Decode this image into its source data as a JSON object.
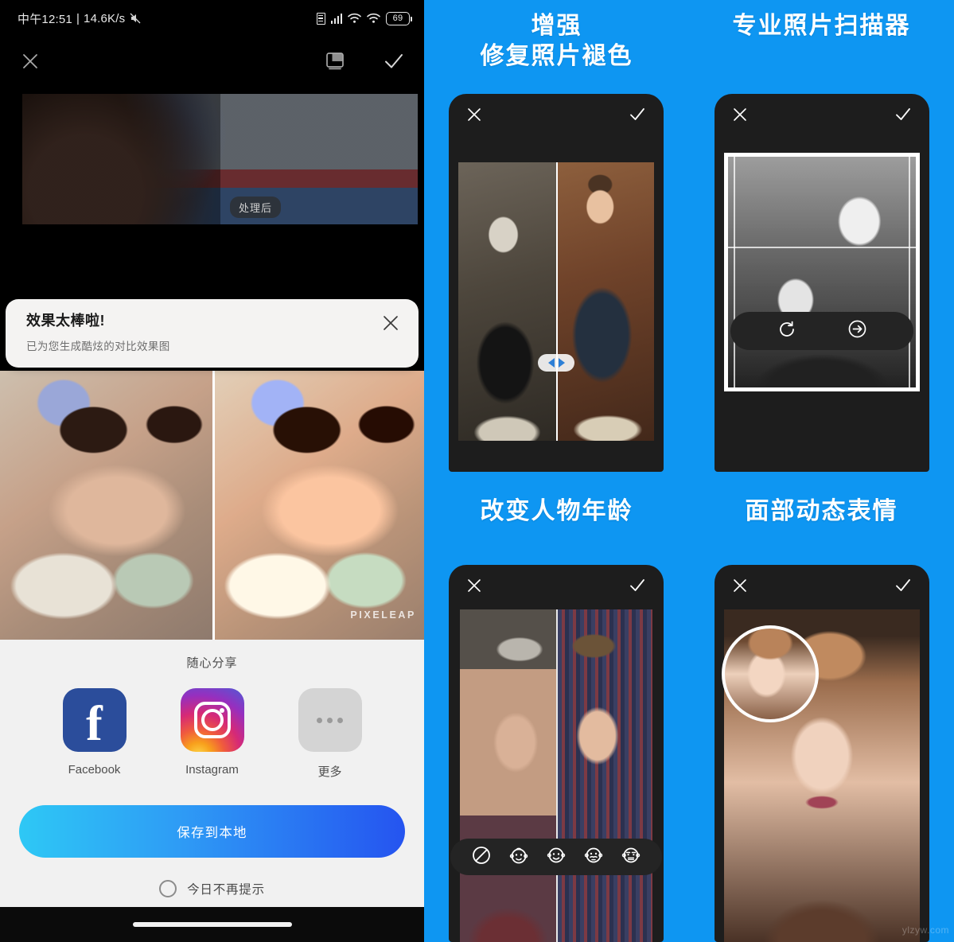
{
  "left_phone": {
    "status_bar": {
      "time": "中午12:51",
      "separator": "|",
      "net_speed": "14.6K/s",
      "mute_icon": "mute-icon",
      "sim_icon": "sim-card-icon",
      "signal_icon": "signal-bars-icon",
      "wifi_icon": "wifi-icon",
      "wifi_secondary_icon": "wifi-secondary-icon",
      "battery_level": "69"
    },
    "editor_toolbar": {
      "close_icon": "close-icon",
      "compare_icon": "compare-layers-icon",
      "confirm_icon": "check-icon"
    },
    "preview": {
      "badge_after": "处理后"
    },
    "toast": {
      "title": "效果太棒啦!",
      "subtitle": "已为您生成酷炫的对比效果图",
      "close_icon": "close-icon"
    },
    "result_image": {
      "watermark": "PIXELEAP"
    },
    "share": {
      "title": "随心分享",
      "apps": [
        {
          "label": "Facebook",
          "icon": "facebook-icon"
        },
        {
          "label": "Instagram",
          "icon": "instagram-icon"
        },
        {
          "label": "更多",
          "icon": "more-dots-icon"
        }
      ],
      "save_button": "保存到本地",
      "dont_remind_label": "今日不再提示",
      "dont_remind_checked": false
    },
    "gesture_bar": "home-indicator"
  },
  "promo_panel": {
    "background_color": "#0e96f2",
    "cells": [
      {
        "heading": "增强\n修复照片褪色",
        "close_icon": "close-icon",
        "confirm_icon": "check-icon",
        "control": "before-after-slider"
      },
      {
        "heading": "专业照片扫描器",
        "close_icon": "close-icon",
        "confirm_icon": "check-icon",
        "toolbar_icons": [
          "rotate-icon",
          "arrow-right-circle-icon"
        ]
      },
      {
        "heading": "改变人物年龄",
        "close_icon": "close-icon",
        "confirm_icon": "check-icon",
        "toolbar_icons": [
          "no-effect-icon",
          "baby-face-icon",
          "young-face-icon",
          "adult-face-icon",
          "old-face-icon"
        ]
      },
      {
        "heading": "面部动态表情",
        "close_icon": "close-icon",
        "confirm_icon": "check-icon",
        "thumbnail": "face-thumbnail"
      }
    ],
    "corner_watermark": "ylzyw.com"
  }
}
